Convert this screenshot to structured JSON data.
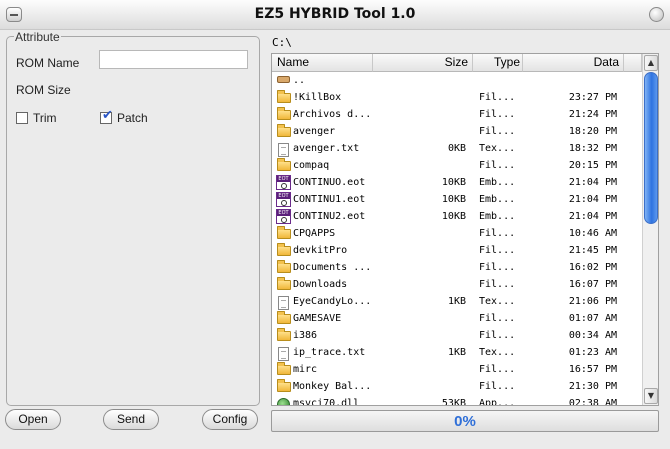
{
  "window": {
    "title": "EZ5 HYBRID Tool 1.0"
  },
  "attribute": {
    "legend": "Attribute",
    "rom_name_label": "ROM Name",
    "rom_name_value": "",
    "rom_size_label": "ROM Size",
    "trim_label": "Trim",
    "trim_checked": false,
    "patch_label": "Patch",
    "patch_checked": true
  },
  "browser": {
    "path": "C:\\",
    "columns": {
      "name": "Name",
      "size": "Size",
      "type": "Type",
      "date": "Data"
    },
    "files": [
      {
        "icon": "up",
        "name": "..",
        "size": "",
        "type": "",
        "date": ""
      },
      {
        "icon": "folder",
        "name": "!KillBox",
        "size": "",
        "type": "Fil...",
        "date": "23:27 PM"
      },
      {
        "icon": "folder",
        "name": "Archivos d...",
        "size": "",
        "type": "Fil...",
        "date": "21:24 PM"
      },
      {
        "icon": "folder",
        "name": "avenger",
        "size": "",
        "type": "Fil...",
        "date": "18:20 PM"
      },
      {
        "icon": "txt",
        "name": "avenger.txt",
        "size": "0KB",
        "type": "Tex...",
        "date": "18:32 PM"
      },
      {
        "icon": "folder",
        "name": "compaq",
        "size": "",
        "type": "Fil...",
        "date": "20:15 PM"
      },
      {
        "icon": "eot",
        "name": "CONTINUO.eot",
        "size": "10KB",
        "type": "Emb...",
        "date": "21:04 PM"
      },
      {
        "icon": "eot",
        "name": "CONTINU1.eot",
        "size": "10KB",
        "type": "Emb...",
        "date": "21:04 PM"
      },
      {
        "icon": "eot",
        "name": "CONTINU2.eot",
        "size": "10KB",
        "type": "Emb...",
        "date": "21:04 PM"
      },
      {
        "icon": "folder",
        "name": "CPQAPPS",
        "size": "",
        "type": "Fil...",
        "date": "10:46 AM"
      },
      {
        "icon": "folder",
        "name": "devkitPro",
        "size": "",
        "type": "Fil...",
        "date": "21:45 PM"
      },
      {
        "icon": "folder",
        "name": "Documents ...",
        "size": "",
        "type": "Fil...",
        "date": "16:02 PM"
      },
      {
        "icon": "folder",
        "name": "Downloads",
        "size": "",
        "type": "Fil...",
        "date": "16:07 PM"
      },
      {
        "icon": "txt",
        "name": "EyeCandyLo...",
        "size": "1KB",
        "type": "Tex...",
        "date": "21:06 PM"
      },
      {
        "icon": "folder",
        "name": "GAMESAVE",
        "size": "",
        "type": "Fil...",
        "date": "01:07 AM"
      },
      {
        "icon": "folder",
        "name": "i386",
        "size": "",
        "type": "Fil...",
        "date": "00:34 AM"
      },
      {
        "icon": "txt",
        "name": "ip_trace.txt",
        "size": "1KB",
        "type": "Tex...",
        "date": "01:23 AM"
      },
      {
        "icon": "folder",
        "name": "mirc",
        "size": "",
        "type": "Fil...",
        "date": "16:57 PM"
      },
      {
        "icon": "folder",
        "name": "Monkey Bal...",
        "size": "",
        "type": "Fil...",
        "date": "21:30 PM"
      },
      {
        "icon": "dll",
        "name": "msvci70.dll",
        "size": "53KB",
        "type": "App...",
        "date": "02:38 AM"
      }
    ]
  },
  "buttons": {
    "open": "Open",
    "send": "Send",
    "config": "Config"
  },
  "progress": {
    "percent": 0,
    "label": "0%"
  }
}
